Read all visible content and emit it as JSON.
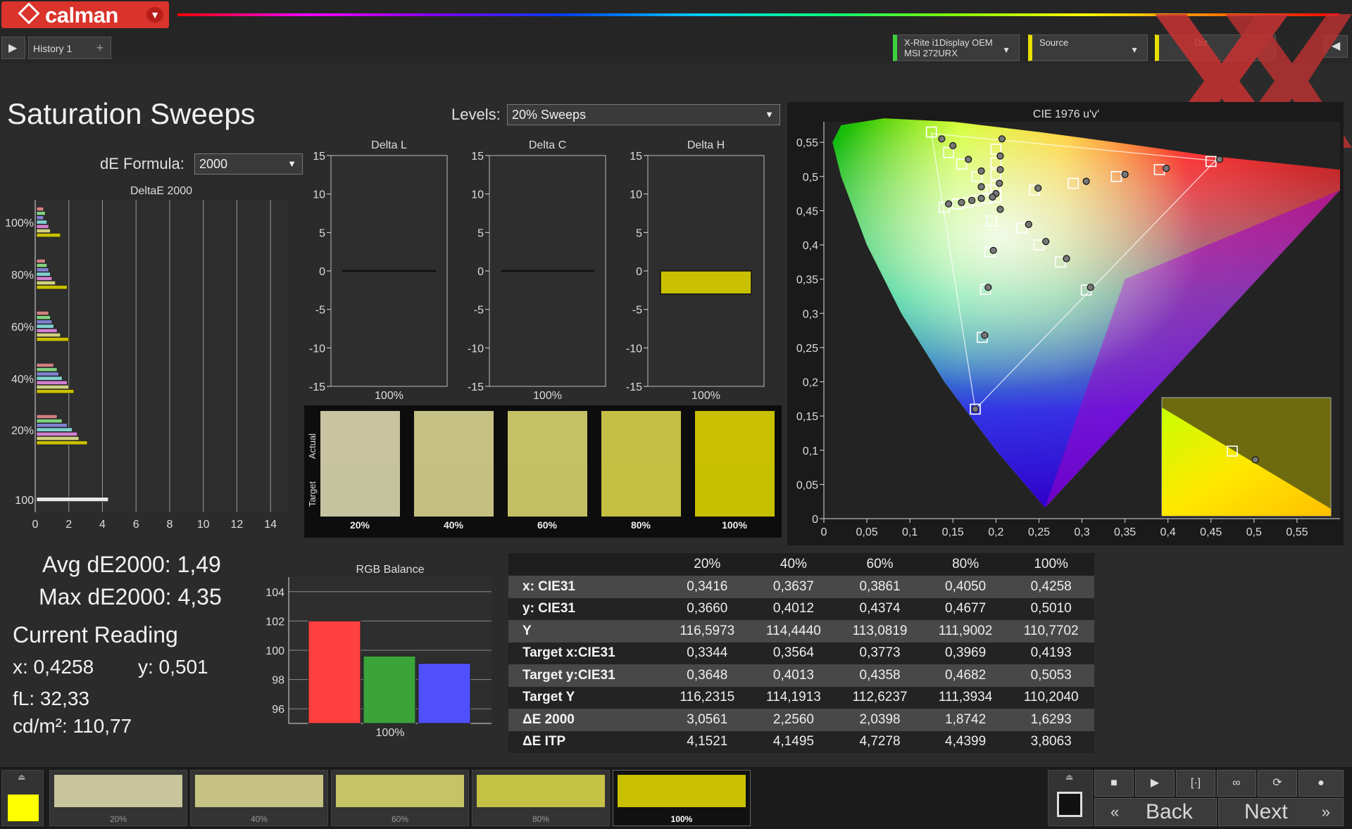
{
  "app": {
    "logo_text": "calman",
    "tab_label": "History 1",
    "tab_add": "+",
    "meter_line1": "X-Rite i1Display OEM",
    "meter_line2": "MSI 272URX",
    "source_label": "Source",
    "display_label": "Dis"
  },
  "page": {
    "title": "Saturation Sweeps",
    "levels_label": "Levels:",
    "levels_value": "20% Sweeps",
    "de_formula_label": "dE Formula:",
    "de_formula_value": "2000"
  },
  "stats": {
    "avg": "Avg dE2000: 1,49",
    "max": "Max dE2000: 4,35",
    "current_reading": "Current Reading",
    "x": "x: 0,4258",
    "y": "y: 0,501",
    "fl": "fL: 32,33",
    "cdm2": "cd/m²: 110,77"
  },
  "colors": {
    "target": "#c8c000",
    "red": "#ff4040",
    "green": "#3aa33a",
    "blue": "#5050ff"
  },
  "chart_data": [
    {
      "type": "bar",
      "orientation": "horizontal",
      "title": "DeltaE 2000",
      "xlim": [
        0,
        15
      ],
      "x_ticks": [
        "0",
        "2",
        "4",
        "6",
        "8",
        "10",
        "12",
        "14"
      ],
      "y_ticks": [
        "100%",
        "80%",
        "60%",
        "40%",
        "20%",
        "100"
      ],
      "groups": [
        {
          "label": "100%",
          "values": [
            0.5,
            0.6,
            0.5,
            0.7,
            0.8,
            0.9,
            1.5
          ],
          "colors": [
            "#d08080",
            "#80d080",
            "#8080d0",
            "#80d0d0",
            "#d080d0",
            "#d0d080",
            "#c8c000"
          ]
        },
        {
          "label": "80%",
          "values": [
            0.6,
            0.7,
            0.8,
            0.9,
            1.0,
            1.2,
            1.9
          ],
          "colors": [
            "#d08080",
            "#80d080",
            "#8080d0",
            "#80d0d0",
            "#d080d0",
            "#d0d080",
            "#c8c000"
          ]
        },
        {
          "label": "60%",
          "values": [
            0.8,
            0.9,
            1.0,
            1.1,
            1.3,
            1.5,
            2.0
          ],
          "colors": [
            "#d08080",
            "#80d080",
            "#8080d0",
            "#80d0d0",
            "#d080d0",
            "#d0d080",
            "#c8c000"
          ]
        },
        {
          "label": "40%",
          "values": [
            1.1,
            1.3,
            1.4,
            1.6,
            1.9,
            2.0,
            2.3
          ],
          "colors": [
            "#d08080",
            "#80d080",
            "#8080d0",
            "#80d0d0",
            "#d080d0",
            "#d0d080",
            "#c8c000"
          ]
        },
        {
          "label": "20%",
          "values": [
            1.3,
            1.6,
            1.9,
            2.2,
            2.5,
            2.6,
            3.1
          ],
          "colors": [
            "#d08080",
            "#80d080",
            "#8080d0",
            "#80d0d0",
            "#d080d0",
            "#d0d080",
            "#c8c000"
          ]
        },
        {
          "label": "100",
          "values": [
            4.35
          ],
          "colors": [
            "#e8e8e8"
          ]
        }
      ]
    },
    {
      "type": "bar",
      "title": "Delta L",
      "categories": [
        "100%"
      ],
      "values": [
        0.05
      ],
      "ylim": [
        -15,
        15
      ],
      "y_ticks": [
        "15",
        "10",
        "5",
        "0",
        "-5",
        "-10",
        "-15"
      ]
    },
    {
      "type": "bar",
      "title": "Delta C",
      "categories": [
        "100%"
      ],
      "values": [
        -0.05
      ],
      "ylim": [
        -15,
        15
      ],
      "y_ticks": [
        "15",
        "10",
        "5",
        "0",
        "-5",
        "-10",
        "-15"
      ]
    },
    {
      "type": "bar",
      "title": "Delta H",
      "categories": [
        "100%"
      ],
      "values": [
        -3.0
      ],
      "ylim": [
        -15,
        15
      ],
      "y_ticks": [
        "15",
        "10",
        "5",
        "0",
        "-5",
        "-10",
        "-15"
      ]
    },
    {
      "type": "bar",
      "title": "RGB Balance",
      "categories": [
        "100%"
      ],
      "series": [
        {
          "values": [
            102.0
          ],
          "color": "#ff4040"
        },
        {
          "values": [
            99.6
          ],
          "color": "#3aa33a"
        },
        {
          "values": [
            99.1
          ],
          "color": "#5050ff"
        }
      ],
      "ylim": [
        95,
        105
      ],
      "y_ticks": [
        "104",
        "102",
        "100",
        "98",
        "96"
      ]
    },
    {
      "type": "scatter",
      "title": "CIE 1976 u'v'",
      "xlim": [
        0,
        0.6
      ],
      "ylim": [
        0,
        0.58
      ],
      "x_ticks": [
        "0",
        "0,05",
        "0,1",
        "0,15",
        "0,2",
        "0,25",
        "0,3",
        "0,35",
        "0,4",
        "0,45",
        "0,5",
        "0,55"
      ],
      "y_ticks": [
        "0",
        "0,05",
        "0,1",
        "0,15",
        "0,2",
        "0,25",
        "0,3",
        "0,35",
        "0,4",
        "0,45",
        "0,5",
        "0,55"
      ],
      "targets": [
        [
          0.2,
          0.54
        ],
        [
          0.2,
          0.52
        ],
        [
          0.2,
          0.503
        ],
        [
          0.2,
          0.486
        ],
        [
          0.2,
          0.47
        ],
        [
          0.125,
          0.565
        ],
        [
          0.145,
          0.535
        ],
        [
          0.16,
          0.518
        ],
        [
          0.178,
          0.5
        ],
        [
          0.195,
          0.48
        ],
        [
          0.14,
          0.455
        ],
        [
          0.155,
          0.46
        ],
        [
          0.167,
          0.462
        ],
        [
          0.178,
          0.465
        ],
        [
          0.19,
          0.468
        ],
        [
          0.245,
          0.48
        ],
        [
          0.29,
          0.49
        ],
        [
          0.34,
          0.5
        ],
        [
          0.39,
          0.51
        ],
        [
          0.45,
          0.522
        ],
        [
          0.195,
          0.435
        ],
        [
          0.23,
          0.425
        ],
        [
          0.25,
          0.4
        ],
        [
          0.275,
          0.375
        ],
        [
          0.305,
          0.334
        ],
        [
          0.193,
          0.39
        ],
        [
          0.188,
          0.335
        ],
        [
          0.184,
          0.265
        ],
        [
          0.176,
          0.16
        ]
      ],
      "measured": [
        [
          0.207,
          0.555
        ],
        [
          0.205,
          0.53
        ],
        [
          0.205,
          0.51
        ],
        [
          0.204,
          0.49
        ],
        [
          0.2,
          0.475
        ],
        [
          0.137,
          0.555
        ],
        [
          0.15,
          0.545
        ],
        [
          0.168,
          0.525
        ],
        [
          0.183,
          0.508
        ],
        [
          0.183,
          0.485
        ],
        [
          0.145,
          0.46
        ],
        [
          0.16,
          0.462
        ],
        [
          0.172,
          0.465
        ],
        [
          0.183,
          0.468
        ],
        [
          0.196,
          0.47
        ],
        [
          0.249,
          0.483
        ],
        [
          0.305,
          0.493
        ],
        [
          0.35,
          0.503
        ],
        [
          0.398,
          0.512
        ],
        [
          0.46,
          0.525
        ],
        [
          0.205,
          0.452
        ],
        [
          0.238,
          0.43
        ],
        [
          0.258,
          0.405
        ],
        [
          0.282,
          0.38
        ],
        [
          0.31,
          0.338
        ],
        [
          0.197,
          0.392
        ],
        [
          0.191,
          0.338
        ],
        [
          0.187,
          0.268
        ],
        [
          0.176,
          0.16
        ]
      ],
      "inset": {
        "target": [
          0.4193,
          0.5053
        ],
        "measured": [
          0.4258,
          0.501
        ]
      }
    },
    {
      "type": "table",
      "columns": [
        "",
        "20%",
        "40%",
        "60%",
        "80%",
        "100%"
      ],
      "rows": [
        [
          "x: CIE31",
          "0,3416",
          "0,3637",
          "0,3861",
          "0,4050",
          "0,4258"
        ],
        [
          "y: CIE31",
          "0,3660",
          "0,4012",
          "0,4374",
          "0,4677",
          "0,5010"
        ],
        [
          "Y",
          "116,5973",
          "114,4440",
          "113,0819",
          "111,9002",
          "110,7702"
        ],
        [
          "Target x:CIE31",
          "0,3344",
          "0,3564",
          "0,3773",
          "0,3969",
          "0,4193"
        ],
        [
          "Target y:CIE31",
          "0,3648",
          "0,4013",
          "0,4358",
          "0,4682",
          "0,5053"
        ],
        [
          "Target Y",
          "116,2315",
          "114,1913",
          "112,6237",
          "111,3934",
          "110,2040"
        ],
        [
          "ΔE 2000",
          "3,0561",
          "2,2560",
          "2,0398",
          "1,8742",
          "1,6293"
        ],
        [
          "ΔE ITP",
          "4,1521",
          "4,1495",
          "4,7278",
          "4,4399",
          "3,8063"
        ]
      ]
    }
  ],
  "swatches": {
    "actual_label": "Actual",
    "target_label": "Target",
    "items": [
      {
        "label": "20%",
        "actual": "#c8c3a0",
        "target": "#c5c29f"
      },
      {
        "label": "40%",
        "actual": "#c6c184",
        "target": "#c4c082"
      },
      {
        "label": "60%",
        "actual": "#c6c066",
        "target": "#c4bf64"
      },
      {
        "label": "80%",
        "actual": "#c6bf45",
        "target": "#c4be42"
      },
      {
        "label": "100%",
        "actual": "#c8c000",
        "target": "#c6bf00"
      }
    ]
  },
  "bottom": {
    "items": [
      {
        "label": "20%",
        "color": "#c7c49e"
      },
      {
        "label": "40%",
        "color": "#c6c283"
      },
      {
        "label": "60%",
        "color": "#c6c266"
      },
      {
        "label": "80%",
        "color": "#c5c145"
      },
      {
        "label": "100%",
        "color": "#c8c000"
      }
    ],
    "back_label": "Back",
    "next_label": "Next",
    "current_color": "#ffff00"
  }
}
